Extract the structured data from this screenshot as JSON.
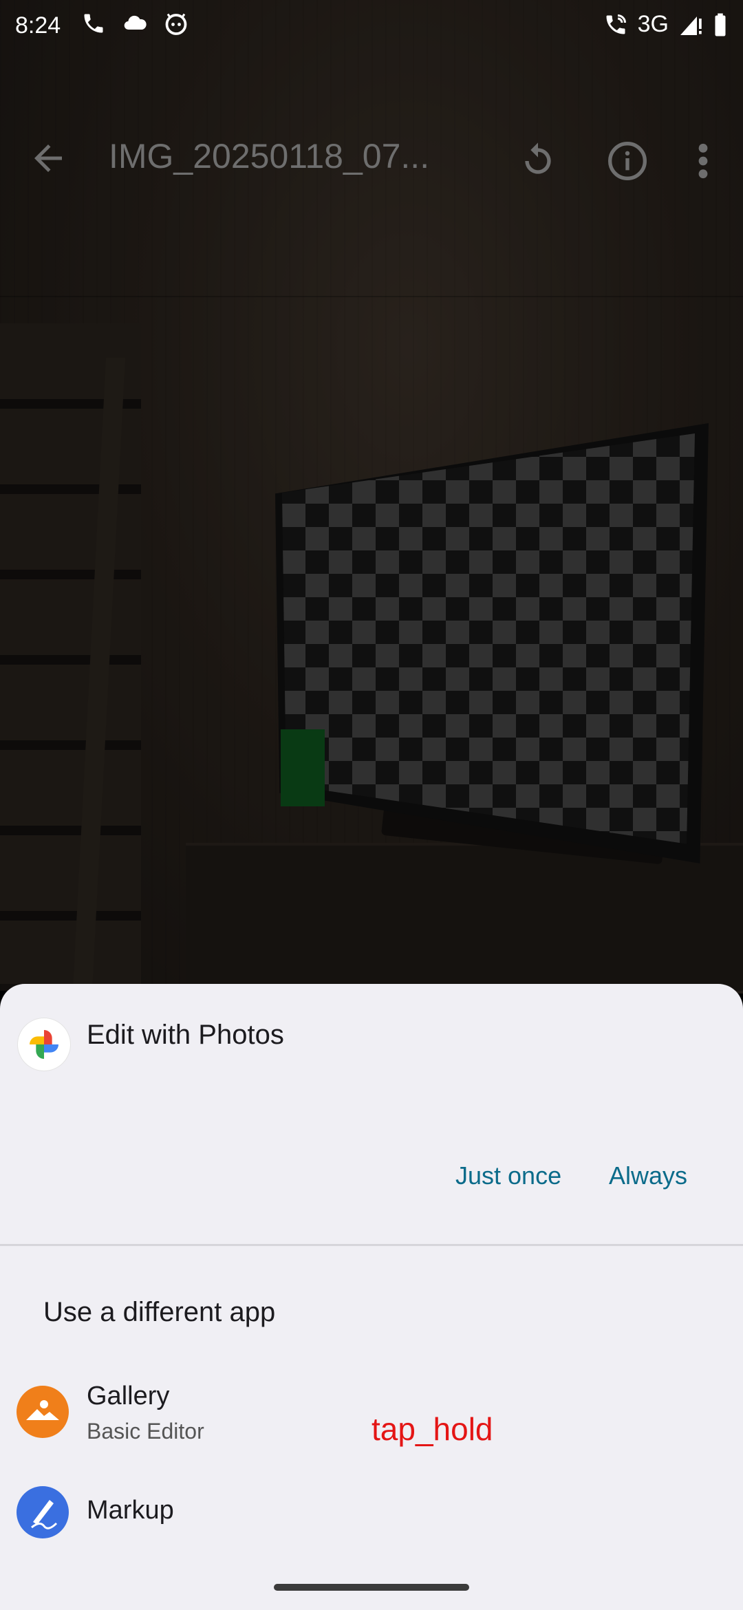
{
  "status_bar": {
    "time": "8:24",
    "network": "3G",
    "left_icons": [
      "phone-icon",
      "cloud-icon",
      "android-icon"
    ],
    "right_icons": [
      "wifi-call-icon",
      "signal-icon",
      "battery-icon"
    ]
  },
  "photo_viewer": {
    "title": "IMG_20250118_07...",
    "actions": [
      "back-arrow-icon",
      "rotate-icon",
      "info-icon",
      "more-vert-icon"
    ]
  },
  "sheet": {
    "app_title": "Edit with Photos",
    "just_once": "Just once",
    "always": "Always",
    "section_label": "Use a different app",
    "apps": [
      {
        "name": "Gallery",
        "subtitle": "Basic Editor",
        "icon": "gallery-icon",
        "color": "#f07f1a"
      },
      {
        "name": "Markup",
        "subtitle": "",
        "icon": "markup-icon",
        "color": "#3a6fe0"
      }
    ]
  },
  "annotation": {
    "label": "tap_hold",
    "color": "#e41515"
  },
  "colors": {
    "accent_link": "#0b6b8a",
    "sheet_background": "#f0eff4"
  }
}
